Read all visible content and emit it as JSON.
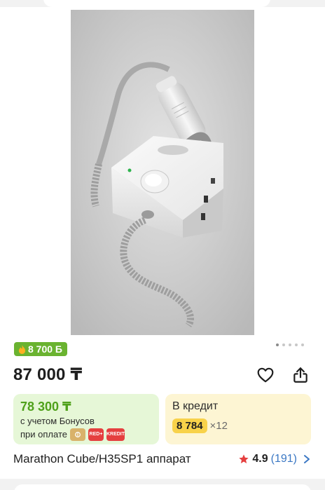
{
  "product": {
    "bonus_badge": "8 700 Б",
    "price": "87 000 ₸",
    "title": "Marathon Cube/H35SP1 аппарат",
    "rating": "4.9",
    "reviews": "(191)"
  },
  "bonus_card": {
    "amount": "78 300 ₸",
    "line1": "с учетом Бонусов",
    "line2": "при оплате",
    "chips": [
      "RED+",
      "KREDIT"
    ]
  },
  "credit_card": {
    "title": "В кредит",
    "monthly": "8 784",
    "months": "×12"
  },
  "gallery": {
    "dots": 5,
    "active_index": 0
  },
  "colors": {
    "bonus_green": "#6ab330",
    "credit_yellow": "#f8d24a",
    "star_red": "#e53f3f",
    "link_blue": "#3b78c4"
  },
  "icons": {
    "favorite": "heart-outline-icon",
    "share": "share-icon",
    "rating": "star-icon",
    "more": "chevron-right-icon",
    "bonus": "flame-icon"
  }
}
